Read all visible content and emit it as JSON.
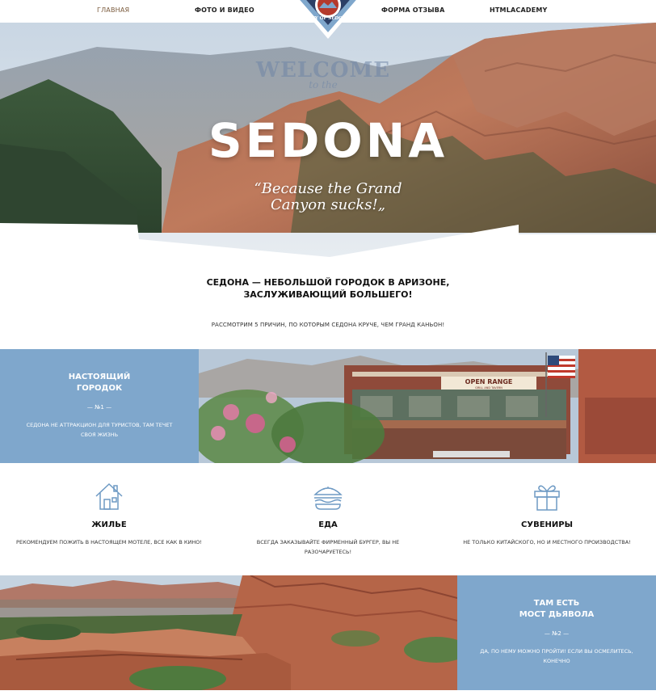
{
  "nav": {
    "items": [
      "ГЛАВНАЯ",
      "ФОТО И ВИДЕО",
      "ФОРМА ОТЗЫВА",
      "HTMLACADEMY"
    ],
    "logo_text": "CITY OF SEDONA"
  },
  "hero": {
    "welcome": "WELCOME",
    "to_the": "to the",
    "title": "SEDONA",
    "tagline_1": "“Because the Grand",
    "tagline_2": "Canyon sucks!„"
  },
  "intro": {
    "heading_1": "СЕДОНА — НЕБОЛЬШОЙ ГОРОДОК В АРИЗОНЕ,",
    "heading_2": "ЗАСЛУЖИВАЮЩИЙ БОЛЬШЕГО!",
    "subtitle": "РАССМОТРИМ 5 ПРИЧИН, ПО КОТОРЫМ СЕДОНА КРУЧЕ, ЧЕМ ГРАНД КАНЬОН!"
  },
  "reason1": {
    "title_1": "НАСТОЯЩИЙ",
    "title_2": "ГОРОДОК",
    "num": "— №1 —",
    "text": "СЕДОНА НЕ АТТРАКЦИОН ДЛЯ ТУРИСТОВ, ТАМ ТЕЧЕТ СВОЯ ЖИЗНЬ",
    "sign": "OPEN RANGE",
    "sign_sub": "GRILL AND TAVERN"
  },
  "features": [
    {
      "icon": "house-icon",
      "title": "ЖИЛЬЕ",
      "text": "РЕКОМЕНДУЕМ ПОЖИТЬ В НАСТОЯЩЕМ МОТЕЛЕ, ВСЕ КАК В КИНО!"
    },
    {
      "icon": "burger-icon",
      "title": "ЕДА",
      "text": "ВСЕГДА ЗАКАЗЫВАЙТЕ ФИРМЕННЫЙ БУРГЕР, ВЫ НЕ РАЗОЧАРУЕТЕСЬ!"
    },
    {
      "icon": "gift-icon",
      "title": "СУВЕНИРЫ",
      "text": "НЕ ТОЛЬКО КИТАЙСКОГО, НО И МЕСТНОГО ПРОИЗВОДСТВА!"
    }
  ],
  "reason2": {
    "title_1": "ТАМ ЕСТЬ",
    "title_2": "МОСТ ДЬЯВОЛА",
    "num": "— №2 —",
    "text": "ДА, ПО НЕМУ МОЖНО ПРОЙТИ! ЕСЛИ ВЫ ОСМЕЛИТЕСЬ, КОНЕЧНО"
  },
  "colors": {
    "accent_blue": "#7fa7cc",
    "nav_active": "#7a5a3c",
    "icon_blue": "#6e9ac4"
  }
}
